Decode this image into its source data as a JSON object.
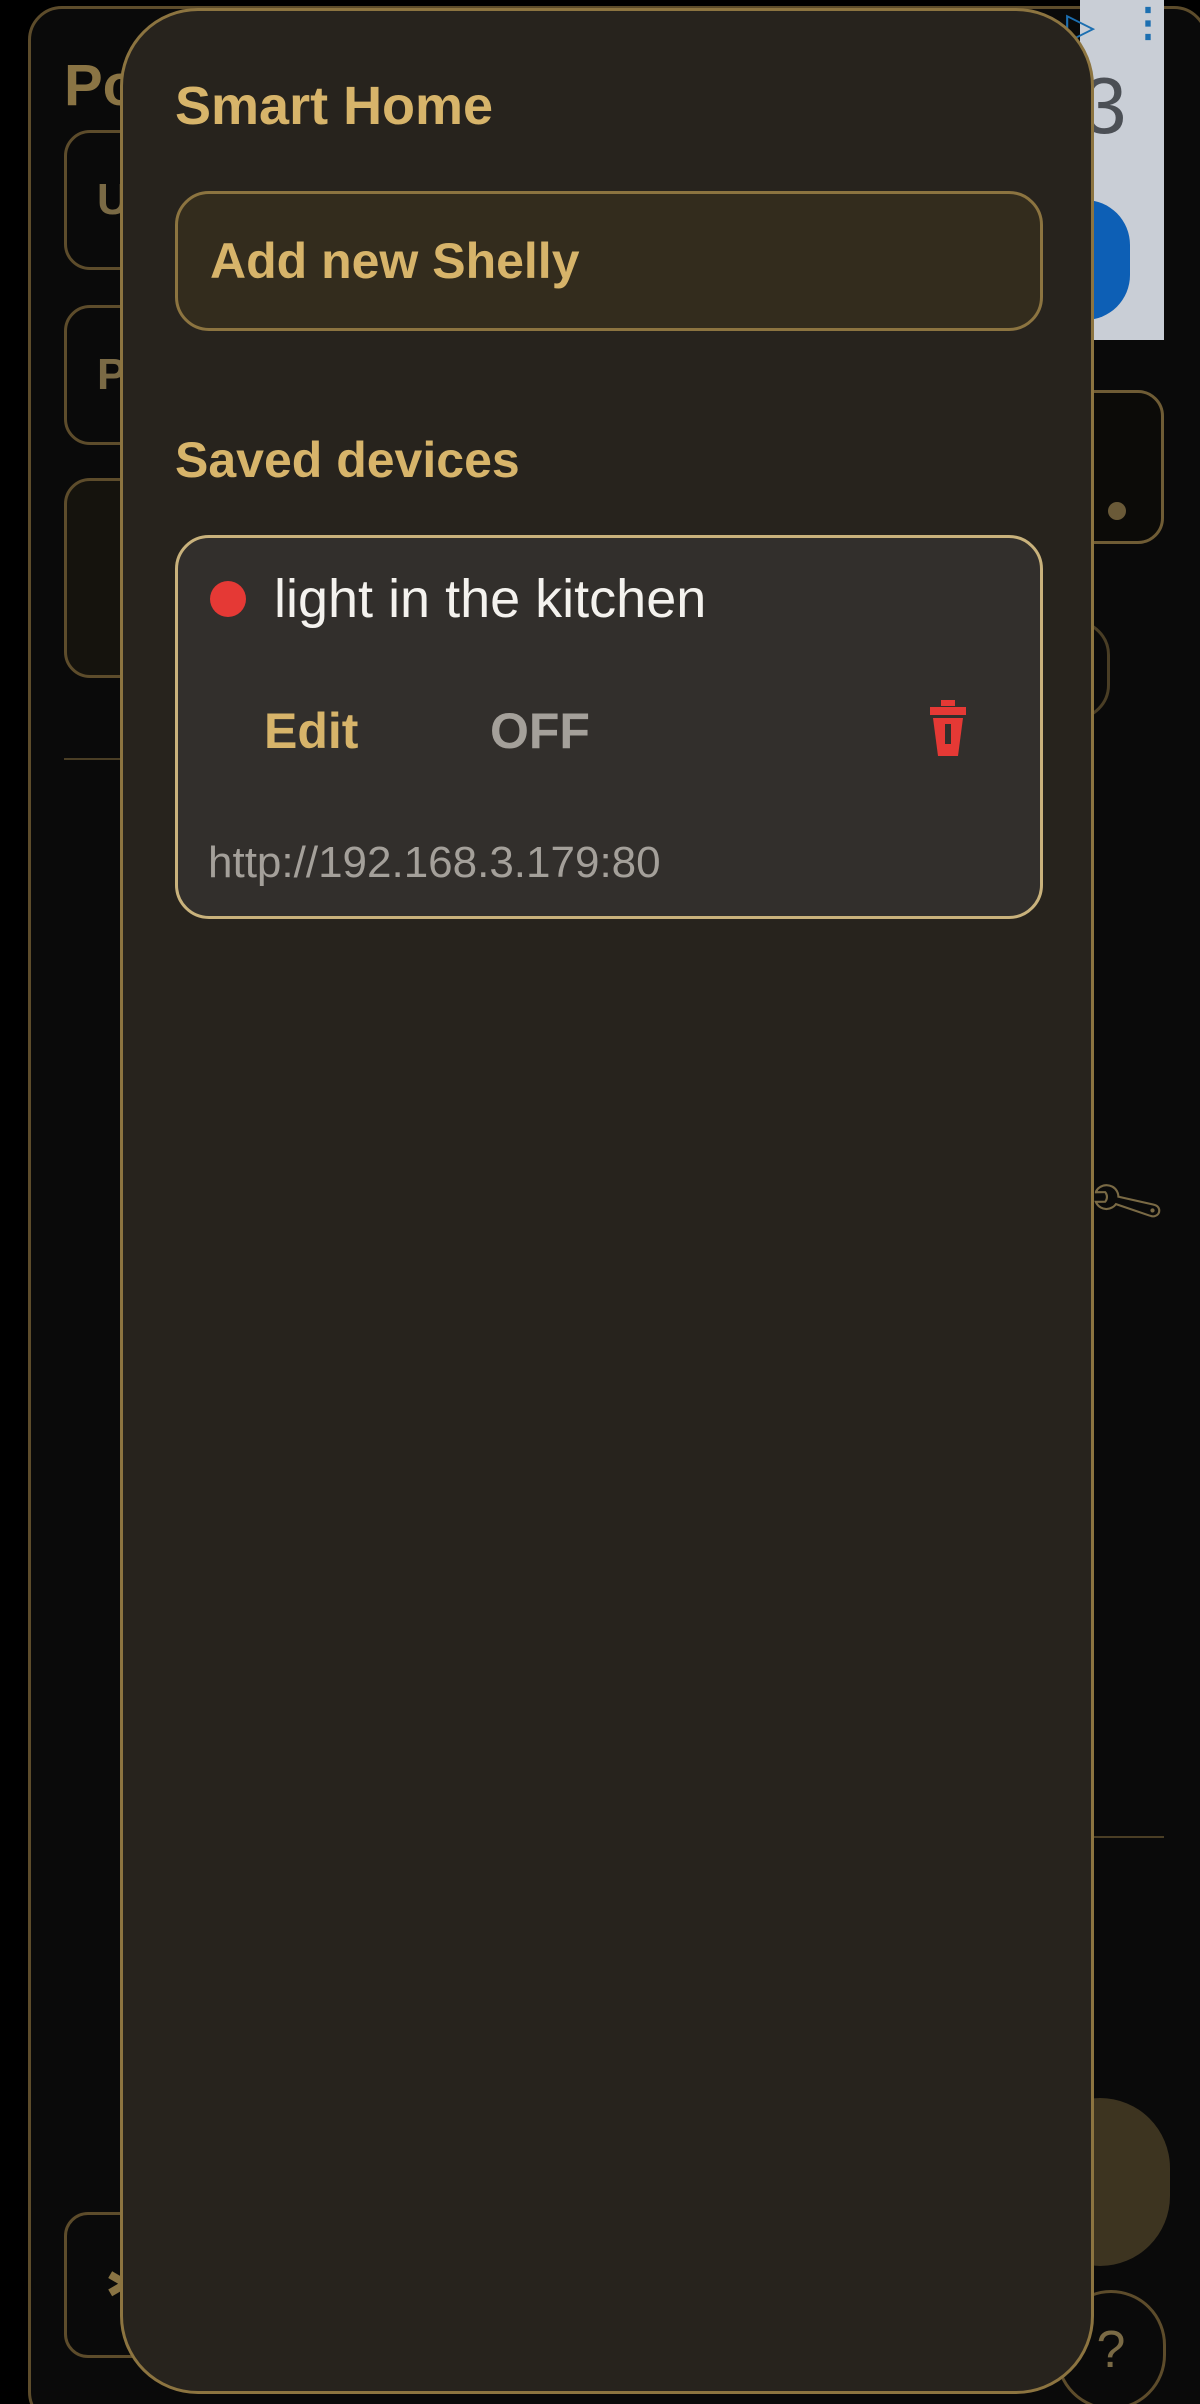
{
  "background_app": {
    "title_partial": "Po",
    "field_1_partial": "U",
    "field_2_partial": "P",
    "ad_digit_partial": "3",
    "help_label": "?"
  },
  "drawer": {
    "title": "Smart Home",
    "add_button_label": "Add new Shelly",
    "saved_section_heading": "Saved devices",
    "devices": [
      {
        "name": "light in the kitchen",
        "status_color": "#e53935",
        "edit_label": "Edit",
        "toggle_label": "OFF",
        "delete_icon": "trash-icon",
        "url": "http://192.168.3.179:80"
      }
    ]
  },
  "colors": {
    "accent_gold": "#d7b46a",
    "drawer_background": "#27231d",
    "card_background": "#322f2c",
    "status_off": "#e53935",
    "delete_red": "#e53935"
  }
}
